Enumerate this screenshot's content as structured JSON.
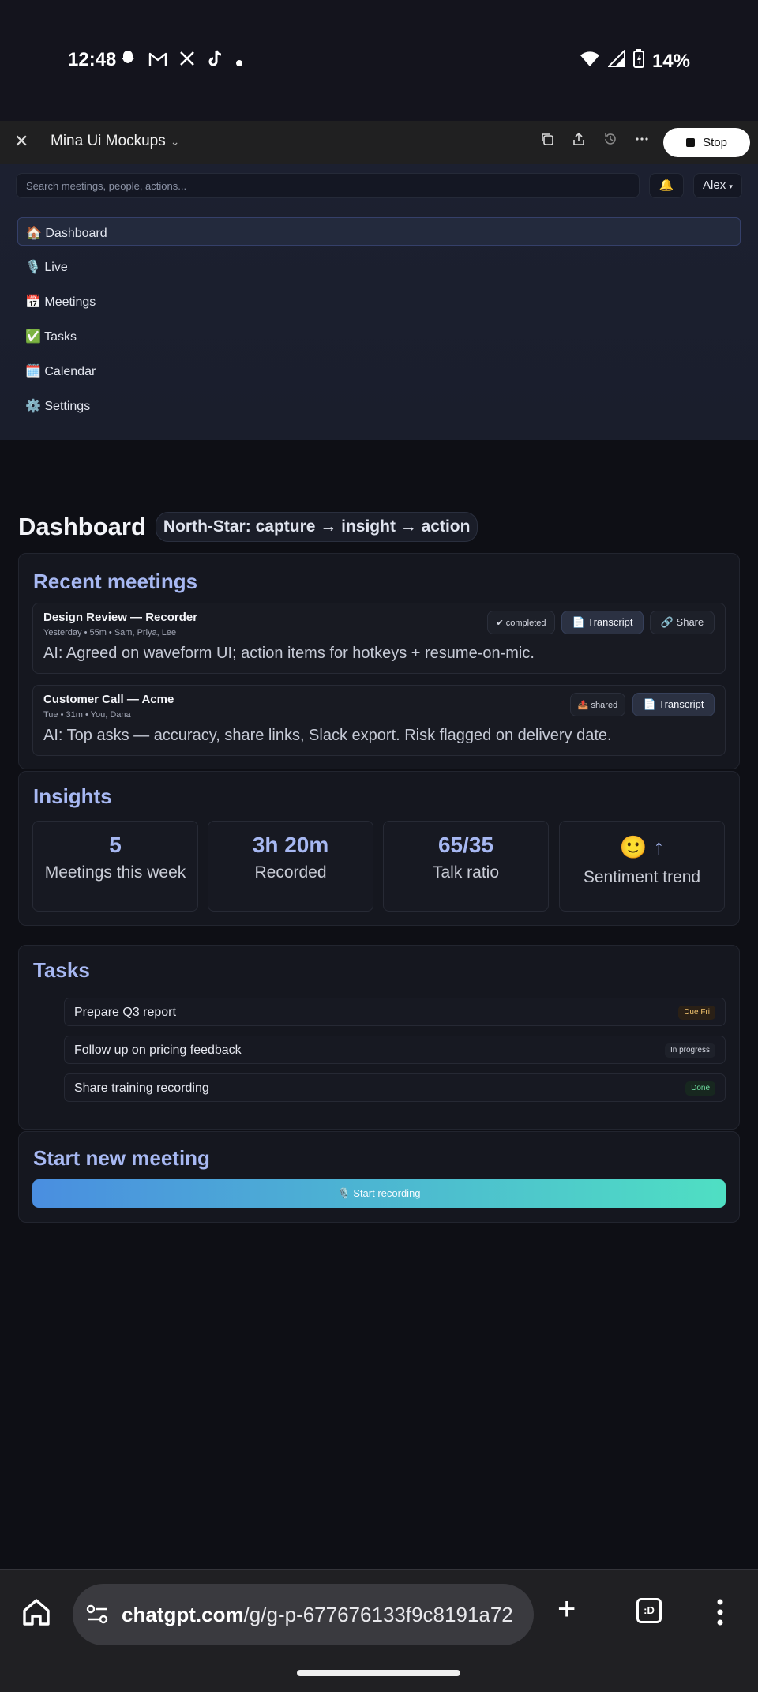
{
  "status_bar": {
    "time": "12:48",
    "battery": "14%"
  },
  "topbar": {
    "title": "Mina Ui Mockups",
    "stop_label": "Stop"
  },
  "app": {
    "search_placeholder": "Search meetings, people, actions...",
    "user": "Alex",
    "nav": [
      {
        "icon": "🏠",
        "label": "Dashboard"
      },
      {
        "icon": "🎙️",
        "label": "Live"
      },
      {
        "icon": "📅",
        "label": "Meetings"
      },
      {
        "icon": "✅",
        "label": "Tasks"
      },
      {
        "icon": "🗓️",
        "label": "Calendar"
      },
      {
        "icon": "⚙️",
        "label": "Settings"
      }
    ]
  },
  "dashboard": {
    "title": "Dashboard",
    "north_star": "North-Star: capture → insight → action",
    "recent": {
      "title": "Recent meetings",
      "meetings": [
        {
          "title": "Design Review — Recorder",
          "meta": "Yesterday • 55m • Sam, Priya, Lee",
          "status": "✔ completed",
          "transcript": "📄 Transcript",
          "share": "🔗 Share",
          "ai": "AI: Agreed on waveform UI; action items for hotkeys + resume-on-mic."
        },
        {
          "title": "Customer Call — Acme",
          "meta": "Tue • 31m • You, Dana",
          "status": "📤 shared",
          "transcript": "📄 Transcript",
          "ai": "AI: Top asks — accuracy, share links, Slack export. Risk flagged on delivery date."
        }
      ]
    },
    "insights": {
      "title": "Insights",
      "stats": [
        {
          "value": "5",
          "label": "Meetings this week"
        },
        {
          "value": "3h 20m",
          "label": "Recorded"
        },
        {
          "value": "65/35",
          "label": "Talk ratio"
        },
        {
          "value": "🙂 ↑",
          "label": "Sentiment trend"
        }
      ]
    },
    "tasks": {
      "title": "Tasks",
      "items": [
        {
          "label": "Prepare Q3 report",
          "badge": "Due Fri"
        },
        {
          "label": "Follow up on pricing feedback",
          "badge": "In progress"
        },
        {
          "label": "Share training recording",
          "badge": "Done"
        }
      ]
    },
    "start": {
      "title": "Start new meeting",
      "button": "🎙️ Start recording"
    }
  },
  "browser": {
    "url_host": "chatgpt.com",
    "url_path": "/g/g-p-677676133f9c8191a72",
    "tabs_label": ":D"
  }
}
